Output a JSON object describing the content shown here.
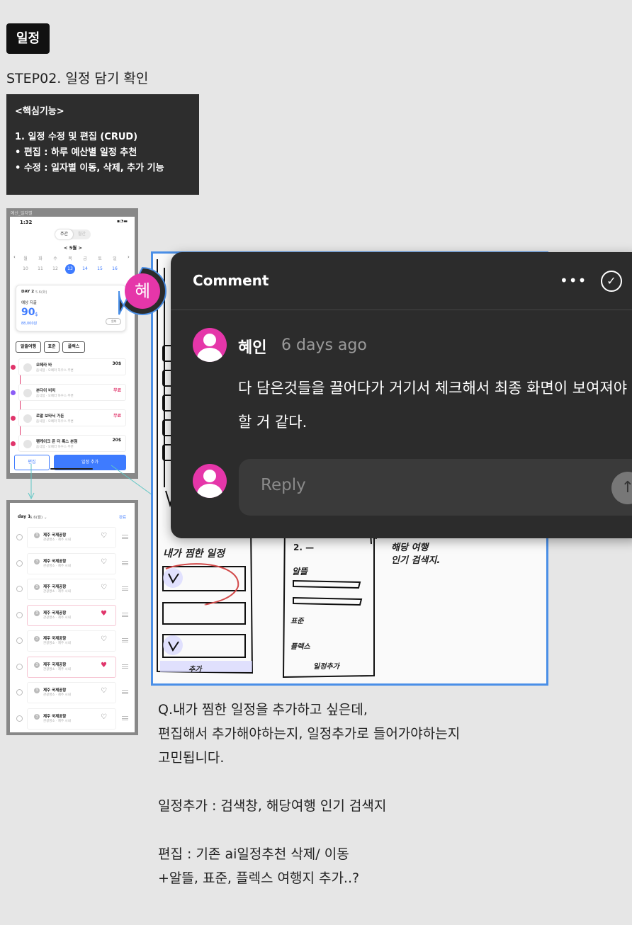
{
  "tag": "일정",
  "step_title": "STEP02. 일정 담기 확인",
  "core_box": {
    "heading": "<핵심기능>",
    "line1": "1. 일정 수정 및 편집 (CRUD)",
    "line2": "•  편집 : 하루 예산별 일정 추천",
    "line3": "•  수정 : 일자별 이동, 삭제, 추가 기능"
  },
  "phone1": {
    "label": "예산_일자별",
    "time": "1:32",
    "status_icons": "▪︎◔▬",
    "seg_on": "주간",
    "seg_off": "월간",
    "month": "< 5월 >",
    "weekdays": [
      "월",
      "화",
      "수",
      "목",
      "금",
      "토",
      "일"
    ],
    "dates": [
      "10",
      "11",
      "12",
      "13",
      "14",
      "15",
      "16"
    ],
    "day_label": "DAY 2",
    "day_date": "5.6(화)",
    "spend_label": "예상 지출",
    "spend_value": "90",
    "spend_unit": "$",
    "spend_won": "88,000원",
    "toggle_label": "원화",
    "pills": [
      "알뜰여행",
      "표준",
      "플렉스"
    ],
    "items": [
      {
        "name": "오페라 바",
        "sub": "음식점 · 오페라 하우스 주변",
        "price": "30$"
      },
      {
        "name": "본다이 비치",
        "sub": "음식점 · 오페라 하우스 주변",
        "price": "무료"
      },
      {
        "name": "로얄 보타닉 가든",
        "sub": "음식점 · 오페라 하우스 주변",
        "price": "무료"
      },
      {
        "name": "팬케이크 온 더 록스 본점",
        "sub": "음식점 · 오페라 하우스 주변",
        "price": "20$"
      }
    ],
    "edit_btn": "편집",
    "add_btn": "일정 추가"
  },
  "phone2": {
    "day": "day 1",
    "date": "5.6(월) ⌄",
    "done": "완료",
    "rows": [
      {
        "num": "3",
        "name": "제주 국제공항",
        "sub": "관광명소 · 제주 시내",
        "liked": false
      },
      {
        "num": "3",
        "name": "제주 국제공항",
        "sub": "관광명소 · 제주 시내",
        "liked": false
      },
      {
        "num": "3",
        "name": "제주 국제공항",
        "sub": "관광명소 · 제주 시내",
        "liked": false
      },
      {
        "num": "3",
        "name": "제주 국제공항",
        "sub": "관광명소 · 제주 시내",
        "liked": true
      },
      {
        "num": "3",
        "name": "제주 국제공항",
        "sub": "관광명소 · 제주 시내",
        "liked": false
      },
      {
        "num": "3",
        "name": "제주 국제공항",
        "sub": "관광명소 · 제주 시내",
        "liked": true
      },
      {
        "num": "3",
        "name": "제주 국제공항",
        "sub": "관광명소 · 제주 시내",
        "liked": false
      },
      {
        "num": "3",
        "name": "제주 국제공항",
        "sub": "관광명소 · 제주 시내",
        "liked": false
      }
    ]
  },
  "sketch": {
    "note_right1": "해당 여행",
    "note_right2": "인기 검색지.",
    "left_title": "내가 찜한 일정",
    "left_bottom": "추가",
    "mid_1": "2. —",
    "mid_2": "알뜰",
    "mid_3": "표준",
    "mid_4": "플렉스",
    "mid_bottom": "일정추가"
  },
  "marker_letter": "혜",
  "comment": {
    "title": "Comment",
    "more": "•••",
    "resolve": "✓",
    "author": "혜인",
    "time": "6 days ago",
    "body": "다 담은것들을 끌어다가 거기서 체크해서 최종 화면이 보여져야할 거 같다.",
    "reply_placeholder": "Reply",
    "send": "↑"
  },
  "question": {
    "l1": "Q.내가 찜한 일정을 추가하고 싶은데,",
    "l2": "편집해서 추가해야하는지, 일정추가로 들어가야하는지",
    "l3": "고민됩니다.",
    "l4": "일정추가 : 검색창, 해당여행 인기 검색지",
    "l5": "편집 : 기존 ai일정추천 삭제/ 이동",
    "l6": "+알뜰, 표준, 플렉스 여행지 추가..?"
  },
  "colors": {
    "accent": "#3e7bff",
    "avatar": "#e536a9",
    "frame": "#4a8fe7",
    "heart": "#e0356b"
  }
}
